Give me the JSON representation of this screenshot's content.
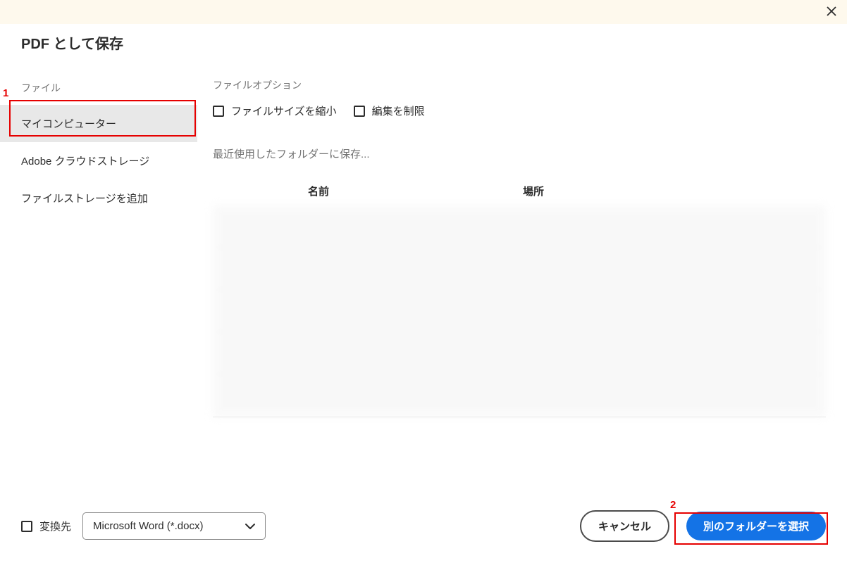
{
  "dialog": {
    "title": "PDF として保存"
  },
  "sidebar": {
    "heading": "ファイル",
    "items": [
      {
        "label": "マイコンピューター"
      },
      {
        "label": "Adobe クラウドストレージ"
      },
      {
        "label": "ファイルストレージを追加"
      }
    ]
  },
  "fileOptions": {
    "heading": "ファイルオプション",
    "reduceSize": "ファイルサイズを縮小",
    "restrictEdit": "編集を制限"
  },
  "recent": {
    "heading": "最近使用したフォルダーに保存...",
    "colName": "名前",
    "colLocation": "場所"
  },
  "footer": {
    "convertTo": "変換先",
    "dropdownValue": "Microsoft Word (*.docx)",
    "cancel": "キャンセル",
    "chooseFolder": "別のフォルダーを選択"
  },
  "annotations": {
    "label1": "1",
    "label2": "2"
  }
}
